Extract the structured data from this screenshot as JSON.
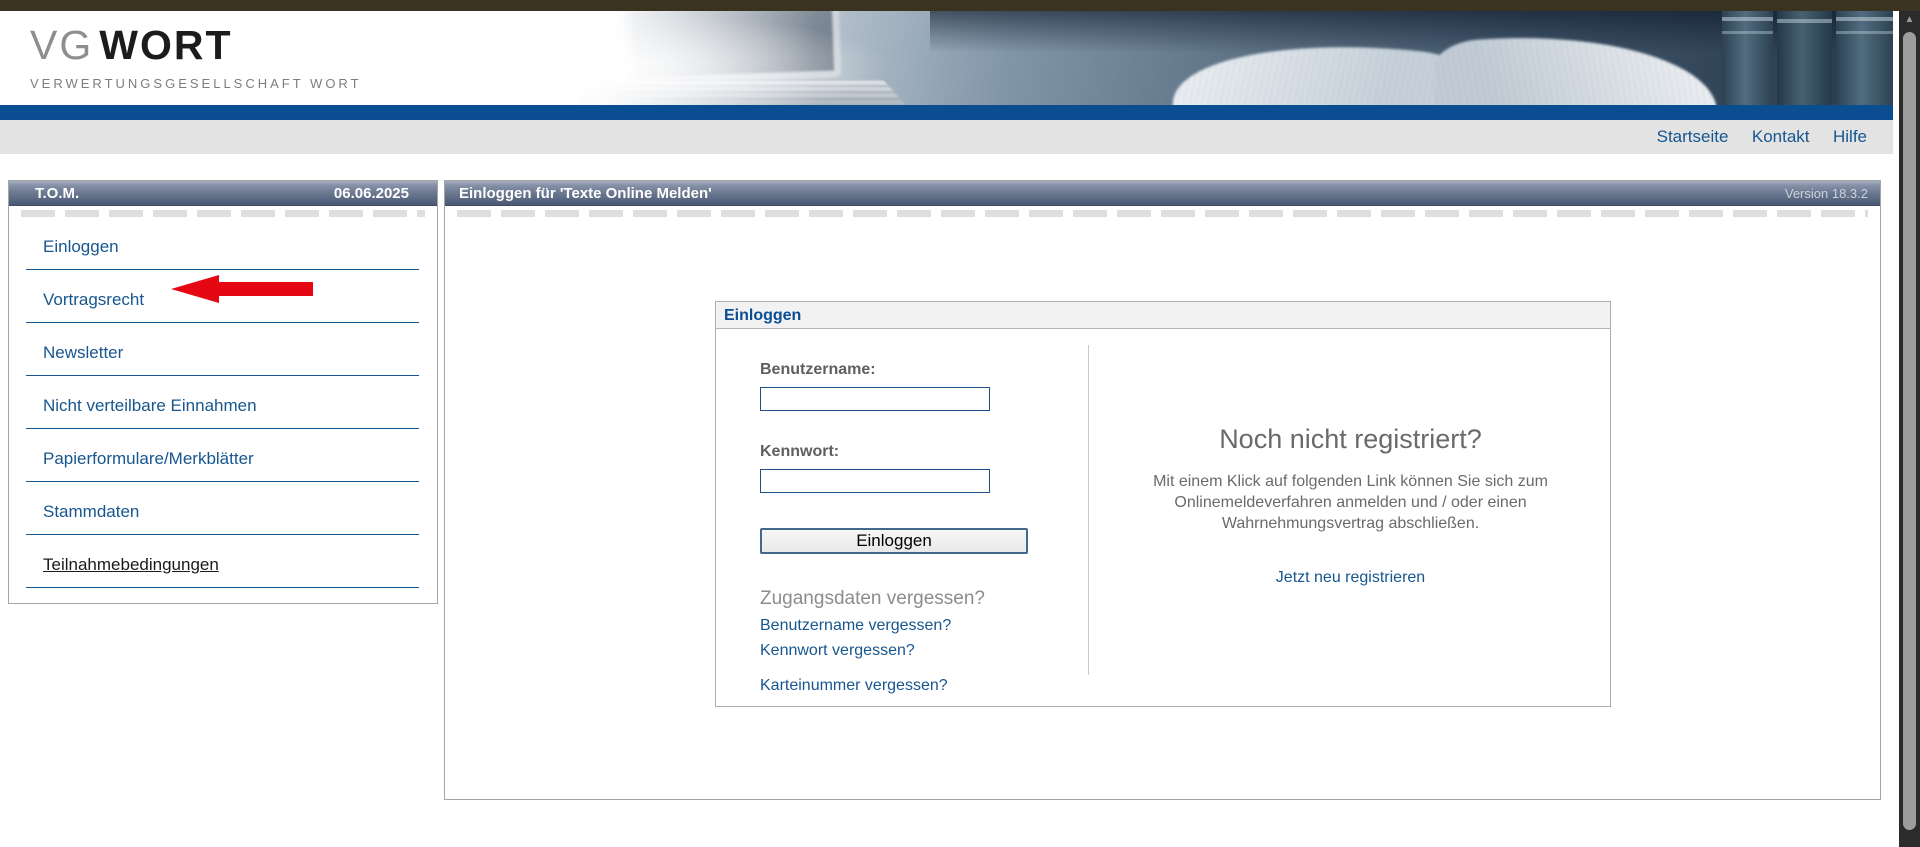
{
  "colors": {
    "link-blue": "#17568f",
    "blue-bar": "#0a4e91",
    "top-bar": "#3a331f",
    "nav-strip-bg": "#e3e3e3",
    "arrow-red": "#e50813",
    "label-gray": "#5f5f5f",
    "muted-gray": "#6d6d6d",
    "panel-border": "#a5a5a5",
    "input-border": "#1c4f87"
  },
  "brand": {
    "logo_vg": "VG",
    "logo_wort": "WORT",
    "subline": "VERWERTUNGSGESELLSCHAFT WORT"
  },
  "top_nav": {
    "links": [
      {
        "label": "Startseite"
      },
      {
        "label": "Kontakt"
      },
      {
        "label": "Hilfe"
      }
    ]
  },
  "sidebar": {
    "title": "T.O.M.",
    "date": "06.06.2025",
    "items": [
      {
        "label": "Einloggen"
      },
      {
        "label": "Vortragsrecht"
      },
      {
        "label": "Newsletter"
      },
      {
        "label": "Nicht verteilbare Einnahmen"
      },
      {
        "label": "Papierformulare/Merkblätter"
      },
      {
        "label": "Stammdaten"
      },
      {
        "label": "Teilnahmebedingungen"
      }
    ]
  },
  "main": {
    "header_title": "Einloggen für 'Texte Online Melden'",
    "version": "Version 18.3.2"
  },
  "login_box": {
    "title": "Einloggen",
    "username_label": "Benutzername:",
    "username_value": "",
    "password_label": "Kennwort:",
    "password_value": "",
    "submit_label": "Einloggen",
    "forgot_heading": "Zugangsdaten vergessen?",
    "forgot_links": [
      {
        "label": "Benutzername vergessen?"
      },
      {
        "label": "Kennwort vergessen?"
      },
      {
        "label": "Karteinummer vergessen?"
      }
    ],
    "register_heading": "Noch nicht registriert?",
    "register_text": "Mit einem Klick auf folgenden Link können Sie sich zum Onlinemeldeverfahren anmelden und / oder einen Wahrnehmungsvertrag abschließen.",
    "register_link": "Jetzt neu registrieren"
  },
  "scrollbar": {
    "up_arrow_glyph": "▲"
  }
}
